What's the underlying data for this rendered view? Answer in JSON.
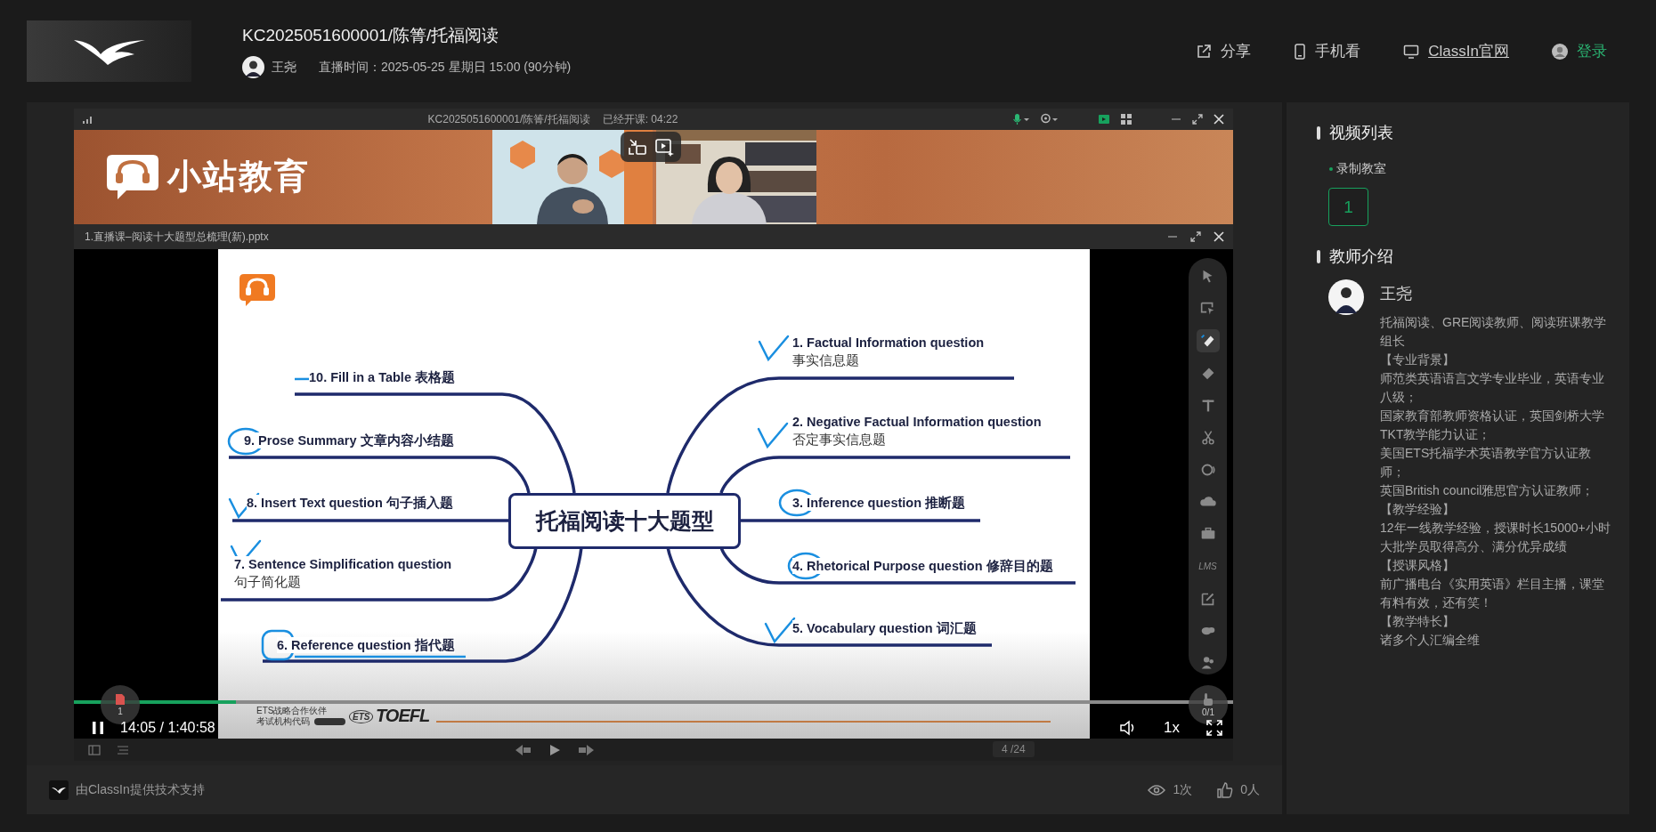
{
  "header": {
    "title": "KC2025051600001/陈箐/托福阅读",
    "host": "王尧",
    "schedule": "直播时间：2025-05-25 星期日 15:00 (90分钟)",
    "links": [
      {
        "label": "分享",
        "kind": "share"
      },
      {
        "label": "手机看",
        "kind": "mobile"
      },
      {
        "label": "ClassIn官网",
        "kind": "site"
      },
      {
        "label": "登录",
        "kind": "login"
      }
    ]
  },
  "player": {
    "title": "KC2025051600001/陈箐/托福阅读",
    "elapsed": "已经开课: 04:22",
    "brand": "小站教育",
    "document": "1.直播课–阅读十大题型总梳理(新).pptx",
    "slide": {
      "heading": "托福阅读十大题型",
      "left_branches": [
        {
          "text": "10. Fill in a Table 表格题",
          "kind": "strike"
        },
        {
          "text": "9. Prose Summary 文章内容小结题",
          "kind": "circle"
        },
        {
          "text": "8. Insert Text question 句子插入题",
          "kind": "check"
        },
        {
          "text": "7. Sentence Simplification question",
          "subtext": "句子简化题",
          "kind": "check"
        },
        {
          "text": "6. Reference question 指代题",
          "kind": "boxed"
        }
      ],
      "right_branches": [
        {
          "text": "1. Factual Information question",
          "subtext": "事实信息题",
          "kind": "check"
        },
        {
          "text": "2. Negative Factual Information question",
          "subtext": "否定事实信息题",
          "kind": "check"
        },
        {
          "text": "3. Inference question 推断题",
          "kind": "circle"
        },
        {
          "text": "4. Rhetorical Purpose question 修辞目的题",
          "kind": "circle"
        },
        {
          "text": "5. Vocabulary question 词汇题",
          "kind": "check"
        }
      ],
      "partner": "ETS战略合作伙伴",
      "code_label": "考试机构代码",
      "ets": "ETS",
      "exam": "TOEFL"
    },
    "tools": [
      {
        "kind": "pointer",
        "selected": false
      },
      {
        "kind": "select",
        "selected": false
      },
      {
        "kind": "pen",
        "selected": true
      },
      {
        "kind": "eraser",
        "selected": false
      },
      {
        "kind": "text",
        "selected": false
      },
      {
        "kind": "scissors",
        "selected": false
      },
      {
        "kind": "laser",
        "selected": false
      },
      {
        "kind": "cloud",
        "selected": false
      },
      {
        "kind": "toolbox",
        "selected": false
      },
      {
        "kind": "lms",
        "label": "LMS",
        "selected": false
      },
      {
        "kind": "edit",
        "selected": false
      },
      {
        "kind": "chat",
        "selected": false
      },
      {
        "kind": "users",
        "selected": false
      }
    ],
    "doc_count": "1",
    "hand_raise": "0/1",
    "playing": true,
    "progress": {
      "level": 0.14
    },
    "time": "14:05 / 1:40:58",
    "speed": "1x",
    "page": "4 /24"
  },
  "sidebar": {
    "video_heading": "视频列表",
    "room": "录制教室",
    "parts": [
      {
        "label": "1",
        "selected": true
      }
    ],
    "teacher_heading": "教师介绍",
    "teacher": "王尧",
    "bio": [
      "托福阅读、GRE阅读教师、阅读班课教学组长",
      "【专业背景】",
      "师范类英语语言文学专业毕业，英语专业八级；",
      "国家教育部教师资格认证，英国剑桥大学TKT教学能力认证；",
      "美国ETS托福学术英语教学官方认证教师；",
      "英国British council雅思官方认证教师；",
      "【教学经验】",
      "12年一线教学经验，授课时长15000+小时",
      "大批学员取得高分、满分优异成绩",
      "【授课风格】",
      "前广播电台《实用英语》栏目主播，课堂有料有效，还有笑！",
      "【教学特长】",
      "诸多个人汇编全维"
    ]
  },
  "footer": {
    "credit": "由ClassIn提供技术支持",
    "views": "1次",
    "likes": "0人"
  }
}
